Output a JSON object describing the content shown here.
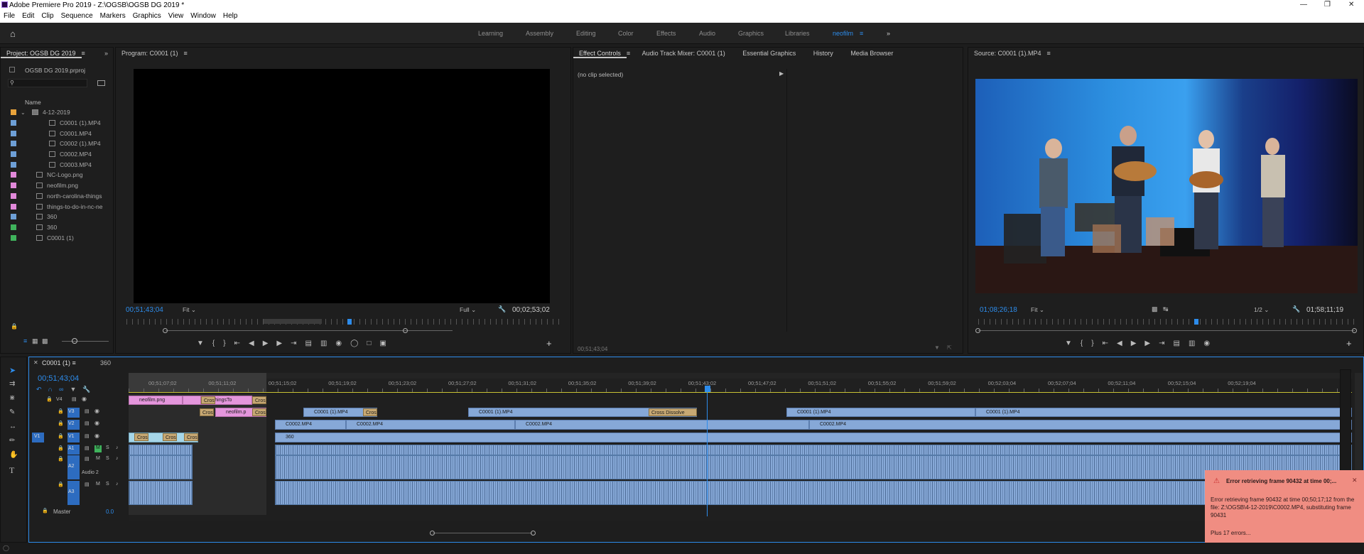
{
  "app": {
    "title": "Adobe Premiere Pro 2019 - Z:\\OGSB\\OGSB DG 2019 *",
    "minimize_icon": "minimize-icon",
    "maximize_icon": "maximize-icon",
    "close_icon": "close-icon"
  },
  "menu": [
    "File",
    "Edit",
    "Clip",
    "Sequence",
    "Markers",
    "Graphics",
    "View",
    "Window",
    "Help"
  ],
  "workspaces": [
    "Learning",
    "Assembly",
    "Editing",
    "Color",
    "Effects",
    "Audio",
    "Graphics",
    "Libraries",
    "neofilm"
  ],
  "project": {
    "tab": "Project: OGSB DG 2019",
    "file": "OGSB DG 2019.prproj",
    "column": "Name",
    "items": [
      {
        "name": "4-12-2019",
        "color": "#e8a33b",
        "kind": "folder"
      },
      {
        "name": "C0001 (1).MP4",
        "color": "#6d9fd6",
        "kind": "clip"
      },
      {
        "name": "C0001.MP4",
        "color": "#6d9fd6",
        "kind": "clip"
      },
      {
        "name": "C0002 (1).MP4",
        "color": "#6d9fd6",
        "kind": "clip"
      },
      {
        "name": "C0002.MP4",
        "color": "#6d9fd6",
        "kind": "clip"
      },
      {
        "name": "C0003.MP4",
        "color": "#6d9fd6",
        "kind": "clip"
      },
      {
        "name": "NC-Logo.png",
        "color": "#e188d9",
        "kind": "image"
      },
      {
        "name": "neofilm.png",
        "color": "#e188d9",
        "kind": "image"
      },
      {
        "name": "north-carolina-things",
        "color": "#e188d9",
        "kind": "image"
      },
      {
        "name": "things-to-do-in-nc-ne",
        "color": "#e188d9",
        "kind": "image"
      },
      {
        "name": "360",
        "color": "#6d9fd6",
        "kind": "clip"
      },
      {
        "name": "360",
        "color": "#3fb35c",
        "kind": "sequence"
      },
      {
        "name": "C0001 (1)",
        "color": "#3fb35c",
        "kind": "sequence"
      }
    ]
  },
  "program": {
    "tab": "Program: C0001 (1)",
    "timecode": "00;51;43;04",
    "zoom": "Fit",
    "quality": "Full",
    "duration": "00;02;53;02"
  },
  "effects": {
    "tabs": [
      "Effect Controls",
      "Audio Track Mixer: C0001 (1)",
      "Essential Graphics",
      "History",
      "Media Browser"
    ],
    "empty": "(no clip selected)",
    "timecode": "00;51;43;04"
  },
  "source": {
    "tab": "Source: C0001 (1).MP4",
    "timecode": "01;08;26;18",
    "zoom": "Fit",
    "quality": "1/2",
    "duration": "01;58;11;19"
  },
  "timeline": {
    "tabs": [
      "C0001 (1)",
      "360"
    ],
    "timecode": "00;51;43;04",
    "ruler": [
      "00;51;07;02",
      "00;51;11;02",
      "00;51;15;02",
      "00;51;19;02",
      "00;51;23;02",
      "00;51;27;02",
      "00;51;31;02",
      "00;51;35;02",
      "00;51;39;02",
      "00;51;43;02",
      "00;51;47;02",
      "00;51;51;02",
      "00;51;55;02",
      "00;51;59;02",
      "00;52;03;04",
      "00;52;07;04",
      "00;52;11;04",
      "00;52;15;04",
      "00;52;19;04"
    ],
    "tracks": [
      "V4",
      "V3",
      "V2",
      "V1",
      "A1",
      "A2",
      "A3"
    ],
    "master": "Master",
    "master_value": "0.0",
    "audio2_label": "Audio 2",
    "clips": {
      "neofilm": "neofilm.png",
      "things": "ThingsTo",
      "neofilm2": "neofilm.p",
      "cross": "Cross",
      "c0001a": "C0001 (1).MP4",
      "c0001b": "C0001 (1).MP4",
      "c0001c": "C0001 (1).MP4",
      "c0001d": "C0001 (1).MP4",
      "dissolve": "Cross Dissolve",
      "c0002a": "C0002.MP4",
      "c0002b": "C0002.MP4",
      "c0002c": "C0002.MP4",
      "c0002d": "C0002.MP4",
      "v1clip": "360"
    }
  },
  "error": {
    "title": "Error retrieving frame 90432 at time 00;...",
    "body": "Error retrieving frame 90432 at time 00;50;17;12 from the file: Z:\\OGSB\\4-12-2019\\C0002.MP4, substituting frame 90431",
    "more": "Plus 17 errors..."
  }
}
